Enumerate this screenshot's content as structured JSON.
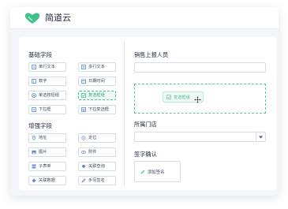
{
  "app": {
    "title": "简道云",
    "brand_color": "#3ec38a"
  },
  "basic_section": {
    "title": "基础字段",
    "items": [
      {
        "label": "单行文本",
        "icon": "single-line-text-icon"
      },
      {
        "label": "多行文本",
        "icon": "multi-line-text-icon"
      },
      {
        "label": "数字",
        "icon": "number-icon"
      },
      {
        "label": "日期时间",
        "icon": "calendar-icon"
      },
      {
        "label": "单选按钮组",
        "icon": "radio-icon"
      },
      {
        "label": "复选框组",
        "icon": "checkbox-icon"
      },
      {
        "label": "下拉框",
        "icon": "dropdown-icon"
      },
      {
        "label": "下拉复选框",
        "icon": "dropdown-multi-icon"
      }
    ]
  },
  "enhanced_section": {
    "title": "增强字段",
    "items": [
      {
        "label": "地址",
        "icon": "location-pin-icon"
      },
      {
        "label": "定位",
        "icon": "target-icon"
      },
      {
        "label": "图片",
        "icon": "image-icon"
      },
      {
        "label": "附件",
        "icon": "paperclip-icon"
      },
      {
        "label": "子表单",
        "icon": "subform-icon"
      },
      {
        "label": "关联查询",
        "icon": "link-search-icon"
      },
      {
        "label": "关联数据",
        "icon": "link-data-icon"
      },
      {
        "label": "手写签名",
        "icon": "pen-icon"
      }
    ]
  },
  "form": {
    "sales_label": "销售上报人员",
    "dragging_label": "复选框组",
    "store_label": "所属门店",
    "signature_label": "签字确认",
    "add_signature": "添加签名"
  }
}
